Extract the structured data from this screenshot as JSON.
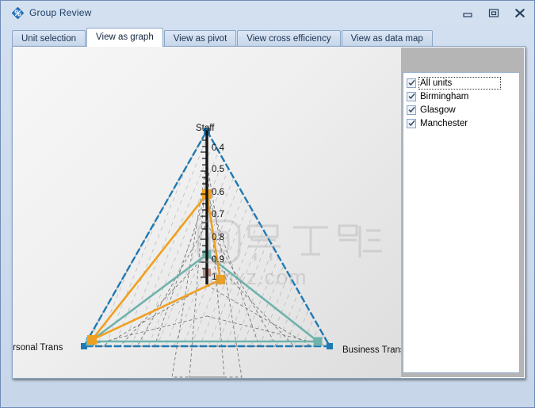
{
  "window": {
    "title": "Group Review",
    "icon": "app-percent-diamond-icon",
    "buttons": {
      "minimize": "minimize-icon",
      "maximize": "maximize-icon",
      "close": "close-icon"
    }
  },
  "tabs": [
    {
      "label": "Unit selection",
      "active": false
    },
    {
      "label": "View as graph",
      "active": true
    },
    {
      "label": "View as pivot",
      "active": false
    },
    {
      "label": "View cross efficiency",
      "active": false
    },
    {
      "label": "View as data map",
      "active": false
    }
  ],
  "unit_list": {
    "items": [
      {
        "label": "All units",
        "checked": true,
        "focused": true
      },
      {
        "label": "Birmingham",
        "checked": true,
        "focused": false
      },
      {
        "label": "Glasgow",
        "checked": true,
        "focused": false
      },
      {
        "label": "Manchester",
        "checked": true,
        "focused": false
      }
    ]
  },
  "watermark": {
    "text": "anxz.com"
  },
  "chart_data": {
    "type": "radar",
    "title": "",
    "axes": [
      "Staff",
      "Business Trans",
      "Personal Trans"
    ],
    "axis_labels": {
      "top": "Staff",
      "right": "Business Trans",
      "left": "Personal Trans"
    },
    "tick_labels": [
      "0.4",
      "0.5",
      "0.6",
      "0.7",
      "0.8",
      "0.9",
      "1"
    ],
    "tick_values": [
      0.4,
      0.5,
      0.6,
      0.7,
      0.8,
      0.9,
      1.0
    ],
    "axis_direction": "inverted-from-vertex",
    "grid": true,
    "legend_position": "right",
    "series": [
      {
        "name": "All units",
        "color": "#1f7ab4",
        "marker": "square",
        "values": {
          "Staff": 0.0,
          "Business Trans": 0.0,
          "Personal Trans": 0.0
        },
        "note": "outer boundary triangle"
      },
      {
        "name": "Birmingham",
        "color": "#f0a020",
        "marker": "square",
        "values": {
          "Staff": 0.6,
          "Business Trans": 1.0,
          "Personal Trans": 0.02
        }
      },
      {
        "name": "Glasgow",
        "color": "#6fb3ac",
        "marker": "square",
        "values": {
          "Staff": 0.8,
          "Business Trans": 0.03,
          "Personal Trans": 0.02
        }
      },
      {
        "name": "Manchester",
        "color": "#b98a85",
        "marker": "square",
        "values": {
          "Staff": 1.0,
          "Business Trans": 1.0,
          "Personal Trans": 1.0
        }
      }
    ]
  },
  "colors": {
    "accent_blue": "#1f7ab4",
    "orange": "#f0a020",
    "teal": "#6fb3ac",
    "rose": "#b98a85",
    "window_chrome": "#cfdcee",
    "panel_gray": "#b5b5b5"
  }
}
